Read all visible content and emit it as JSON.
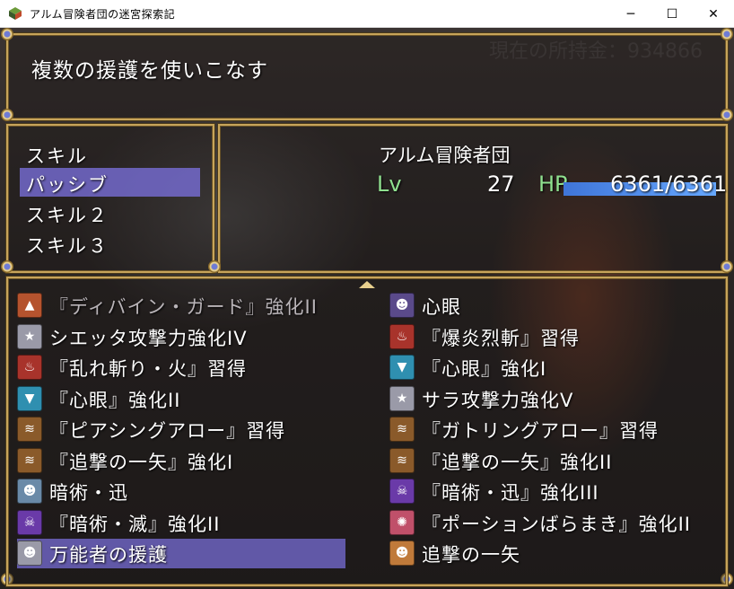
{
  "window": {
    "title": "アルム冒険者団の迷宮探索記",
    "minimize": "─",
    "maximize": "☐",
    "close": "✕"
  },
  "help": {
    "text": "複数の援護を使いこなす"
  },
  "gold": {
    "label": "現在の所持金：934866"
  },
  "commands": [
    {
      "label": "スキル",
      "selected": false
    },
    {
      "label": "パッシブ",
      "selected": true
    },
    {
      "label": "スキル２",
      "selected": false
    },
    {
      "label": "スキル３",
      "selected": false
    }
  ],
  "actor": {
    "name": "アルム冒険者団",
    "lv_label": "Lv",
    "level": "27",
    "hp_label": "HP",
    "hp": "6361/6361",
    "hp_fraction": 1.0
  },
  "skills": [
    {
      "name": "『ディバイン・ガード』強化II",
      "icon": "shield-def-icon",
      "icon_color": "#b5532e",
      "dim": true
    },
    {
      "name": "心眼",
      "icon": "character-portrait-icon",
      "icon_color": "#5a4a8a",
      "dim": false
    },
    {
      "name": "シエッタ攻撃力強化IV",
      "icon": "star-icon",
      "icon_color": "#9a9aa8",
      "dim": false
    },
    {
      "name": "『爆炎烈斬』習得",
      "icon": "fire-icon",
      "icon_color": "#a8332b",
      "dim": false
    },
    {
      "name": "『乱れ斬り・火』習得",
      "icon": "fire-icon",
      "icon_color": "#a8332b",
      "dim": false
    },
    {
      "name": "『心眼』強化I",
      "icon": "def-down-icon",
      "icon_color": "#2f8fb0",
      "dim": false
    },
    {
      "name": "『心眼』強化II",
      "icon": "def-down-icon",
      "icon_color": "#2f8fb0",
      "dim": false
    },
    {
      "name": "サラ攻撃力強化V",
      "icon": "star-icon",
      "icon_color": "#9a9aa8",
      "dim": false
    },
    {
      "name": "『ピアシングアロー』習得",
      "icon": "claw-icon",
      "icon_color": "#8a5a2a",
      "dim": false
    },
    {
      "name": "『ガトリングアロー』習得",
      "icon": "claw-icon",
      "icon_color": "#8a5a2a",
      "dim": false
    },
    {
      "name": "『追撃の一矢』強化I",
      "icon": "claw-icon",
      "icon_color": "#8a5a2a",
      "dim": false
    },
    {
      "name": "『追撃の一矢』強化II",
      "icon": "claw-icon",
      "icon_color": "#8a5a2a",
      "dim": false
    },
    {
      "name": "暗術・迅",
      "icon": "character-portrait-icon",
      "icon_color": "#6a8aa8",
      "dim": false
    },
    {
      "name": "『暗術・迅』強化III",
      "icon": "dark-skull-icon",
      "icon_color": "#6a3aa8",
      "dim": false
    },
    {
      "name": "『暗術・滅』強化II",
      "icon": "dark-skull-icon",
      "icon_color": "#6a3aa8",
      "dim": false
    },
    {
      "name": "『ポーションばらまき』強化II",
      "icon": "potion-burst-icon",
      "icon_color": "#c0506a",
      "dim": false
    },
    {
      "name": "万能者の援護",
      "icon": "character-portrait-icon",
      "icon_color": "#9a9aa8",
      "dim": false,
      "selected": true
    },
    {
      "name": "追撃の一矢",
      "icon": "character-portrait-icon",
      "icon_color": "#c07a3a",
      "dim": false
    }
  ],
  "scroll": {
    "up_arrow": "scroll-up-arrow"
  }
}
